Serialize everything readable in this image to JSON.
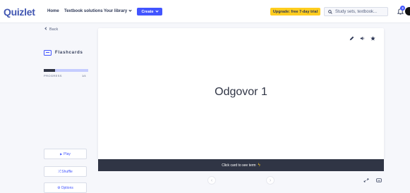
{
  "header": {
    "logo": "Quizlet",
    "nav": [
      "Home",
      "Textbook solutions",
      "Your library"
    ],
    "create_label": "Create",
    "upgrade_label": "Upgrade: free 7-day trial",
    "search_placeholder": "Study sets, textbook...",
    "notification_count": "3"
  },
  "sidebar": {
    "back_label": "Back",
    "mode_label": "Flashcards",
    "progress_label": "PROGRESS",
    "progress_count": "1/4",
    "progress_fraction": 0.25,
    "play_label": "Play",
    "shuffle_label": "Shuffle",
    "options_label": "Options"
  },
  "card": {
    "term": "Odgovor 1",
    "hint": "Click card to see term"
  },
  "colors": {
    "brand": "#4257b2",
    "accent": "#4255ff",
    "upgrade": "#ffcd1f",
    "dark_bar": "#303545"
  }
}
